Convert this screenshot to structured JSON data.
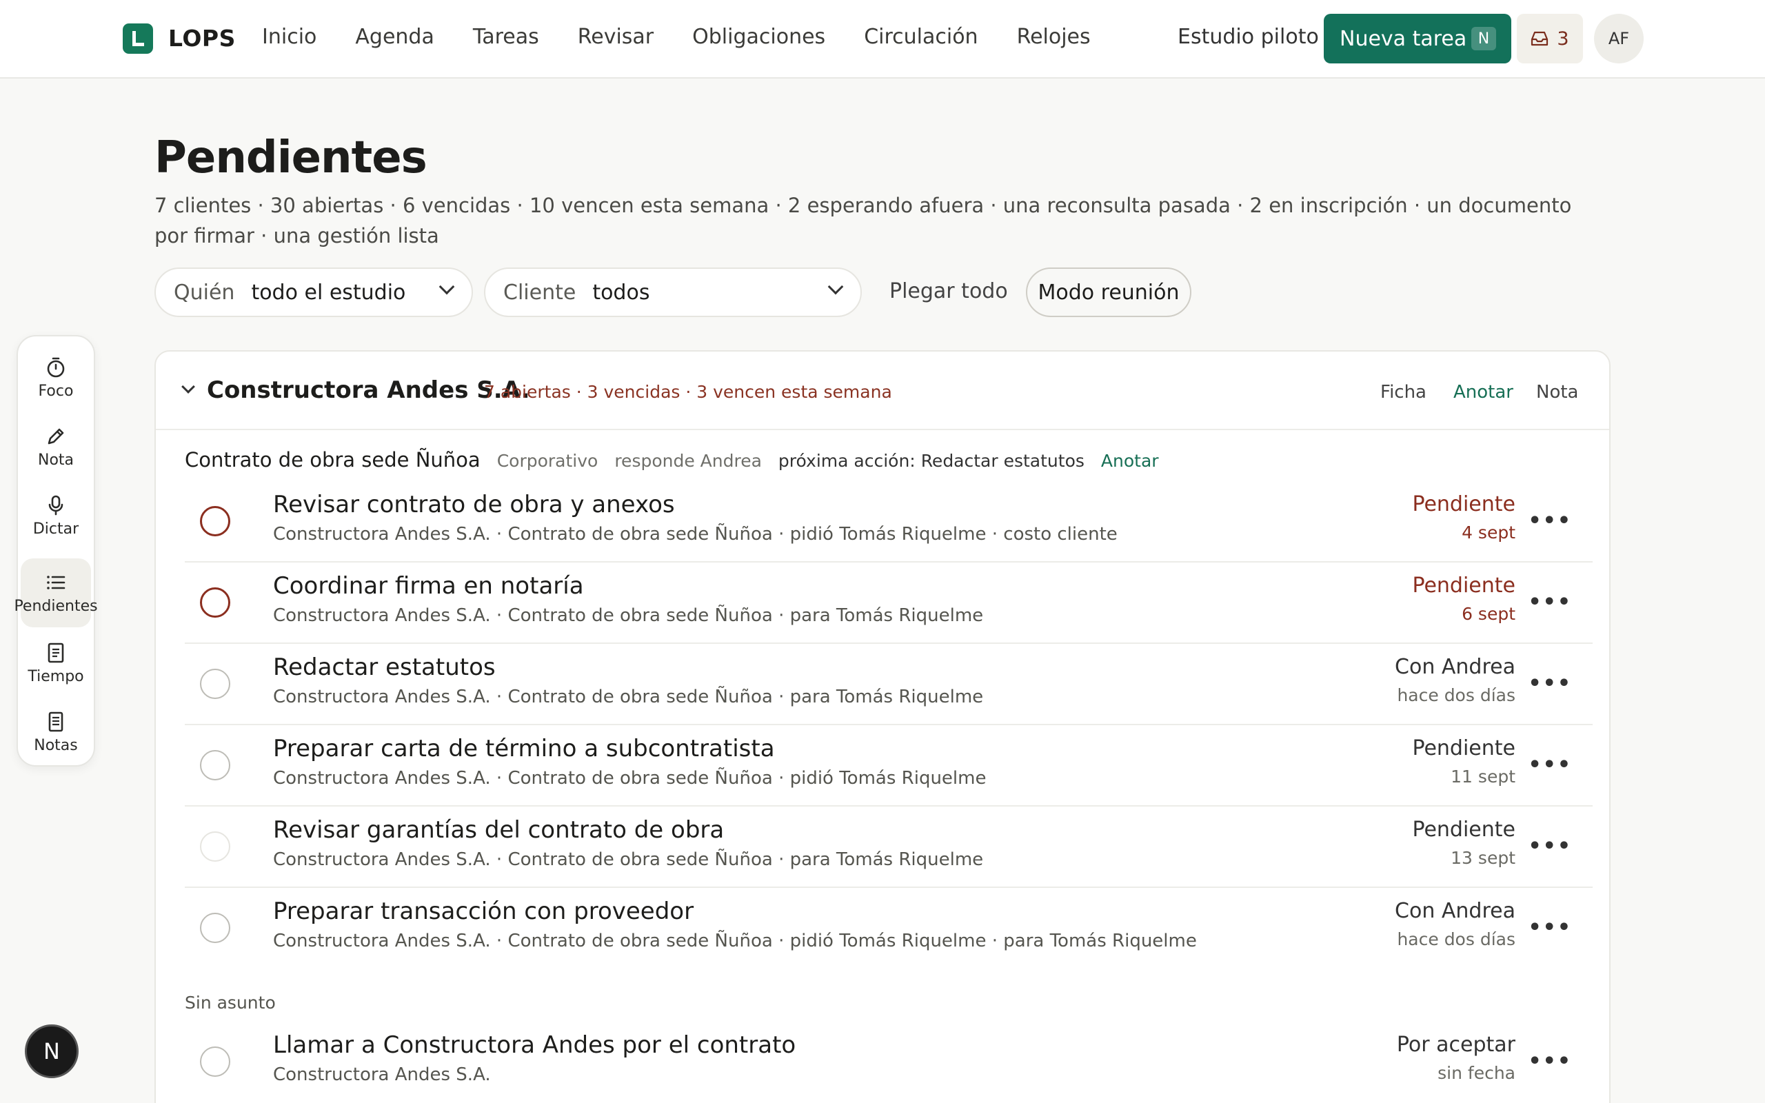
{
  "nav": {
    "brand": "LOPS",
    "links": [
      "Inicio",
      "Agenda",
      "Tareas",
      "Revisar",
      "Obligaciones",
      "Circulación",
      "Relojes"
    ],
    "studio": "Estudio piloto",
    "new_task_label": "Nueva tarea",
    "new_task_key": "N",
    "inbox_count": "3",
    "avatar_initials": "AF"
  },
  "rail": {
    "items": [
      {
        "label": "Foco",
        "icon": "timer-icon"
      },
      {
        "label": "Nota",
        "icon": "pencil-icon"
      },
      {
        "label": "Dictar",
        "icon": "microphone-icon"
      },
      {
        "label": "Pendientes",
        "icon": "list-icon",
        "active": true
      },
      {
        "label": "Tiempo",
        "icon": "document-icon"
      },
      {
        "label": "Notas",
        "icon": "notes-icon"
      }
    ]
  },
  "page": {
    "title": "Pendientes",
    "summary": "7 clientes · 30 abiertas · 6 vencidas · 10 vencen esta semana · 2 esperando afuera · una reconsulta pasada · 2 en inscripción · un documento por firmar · una gestión lista"
  },
  "filters": {
    "who_label": "Quién",
    "who_value": "todo el estudio",
    "client_label": "Cliente",
    "client_value": "todos",
    "collapse_all": "Plegar todo",
    "meeting_mode": "Modo reunión"
  },
  "client": {
    "name": "Constructora Andes S.A.",
    "stats": "7 abiertas · 3 vencidas · 3 vencen esta semana",
    "actions": [
      "Ficha",
      "Anotar",
      "Nota"
    ],
    "matter": {
      "name": "Contrato de obra sede Ñuñoa",
      "area": "Corporativo",
      "responsible": "responde Andrea",
      "next_label": "próxima acción:",
      "next_value": "Redactar estatutos",
      "link": "Anotar"
    },
    "tasks": [
      {
        "title": "Revisar contrato de obra y anexos",
        "sub": "Constructora Andes S.A. · Contrato de obra sede Ñuñoa · pidió Tomás Riquelme · costo cliente",
        "status": "Pendiente",
        "date": "4 sept",
        "late": true
      },
      {
        "title": "Coordinar firma en notaría",
        "sub": "Constructora Andes S.A. · Contrato de obra sede Ñuñoa · para Tomás Riquelme",
        "status": "Pendiente",
        "date": "6 sept",
        "late": true
      },
      {
        "title": "Redactar estatutos",
        "sub": "Constructora Andes S.A. · Contrato de obra sede Ñuñoa · para Tomás Riquelme",
        "status": "Con Andrea",
        "date": "hace dos días",
        "late": false
      },
      {
        "title": "Preparar carta de término a subcontratista",
        "sub": "Constructora Andes S.A. · Contrato de obra sede Ñuñoa · pidió Tomás Riquelme",
        "status": "Pendiente",
        "date": "11 sept",
        "late": false
      },
      {
        "title": "Revisar garantías del contrato de obra",
        "sub": "Constructora Andes S.A. · Contrato de obra sede Ñuñoa · para Tomás Riquelme",
        "status": "Pendiente",
        "date": "13 sept",
        "late": false
      },
      {
        "title": "Preparar transacción con proveedor",
        "sub": "Constructora Andes S.A. · Contrato de obra sede Ñuñoa · pidió Tomás Riquelme · para Tomás Riquelme",
        "status": "Con Andrea",
        "date": "hace dos días",
        "late": false
      }
    ],
    "no_matter_label": "Sin asunto",
    "loose_task": {
      "title": "Llamar a Constructora Andes por el contrato",
      "sub": "Constructora Andes S.A.",
      "status": "Por aceptar",
      "date": "sin fecha"
    }
  },
  "dev_badge": "N",
  "colors": {
    "accent": "#13715a",
    "late": "#8b2e1f"
  }
}
